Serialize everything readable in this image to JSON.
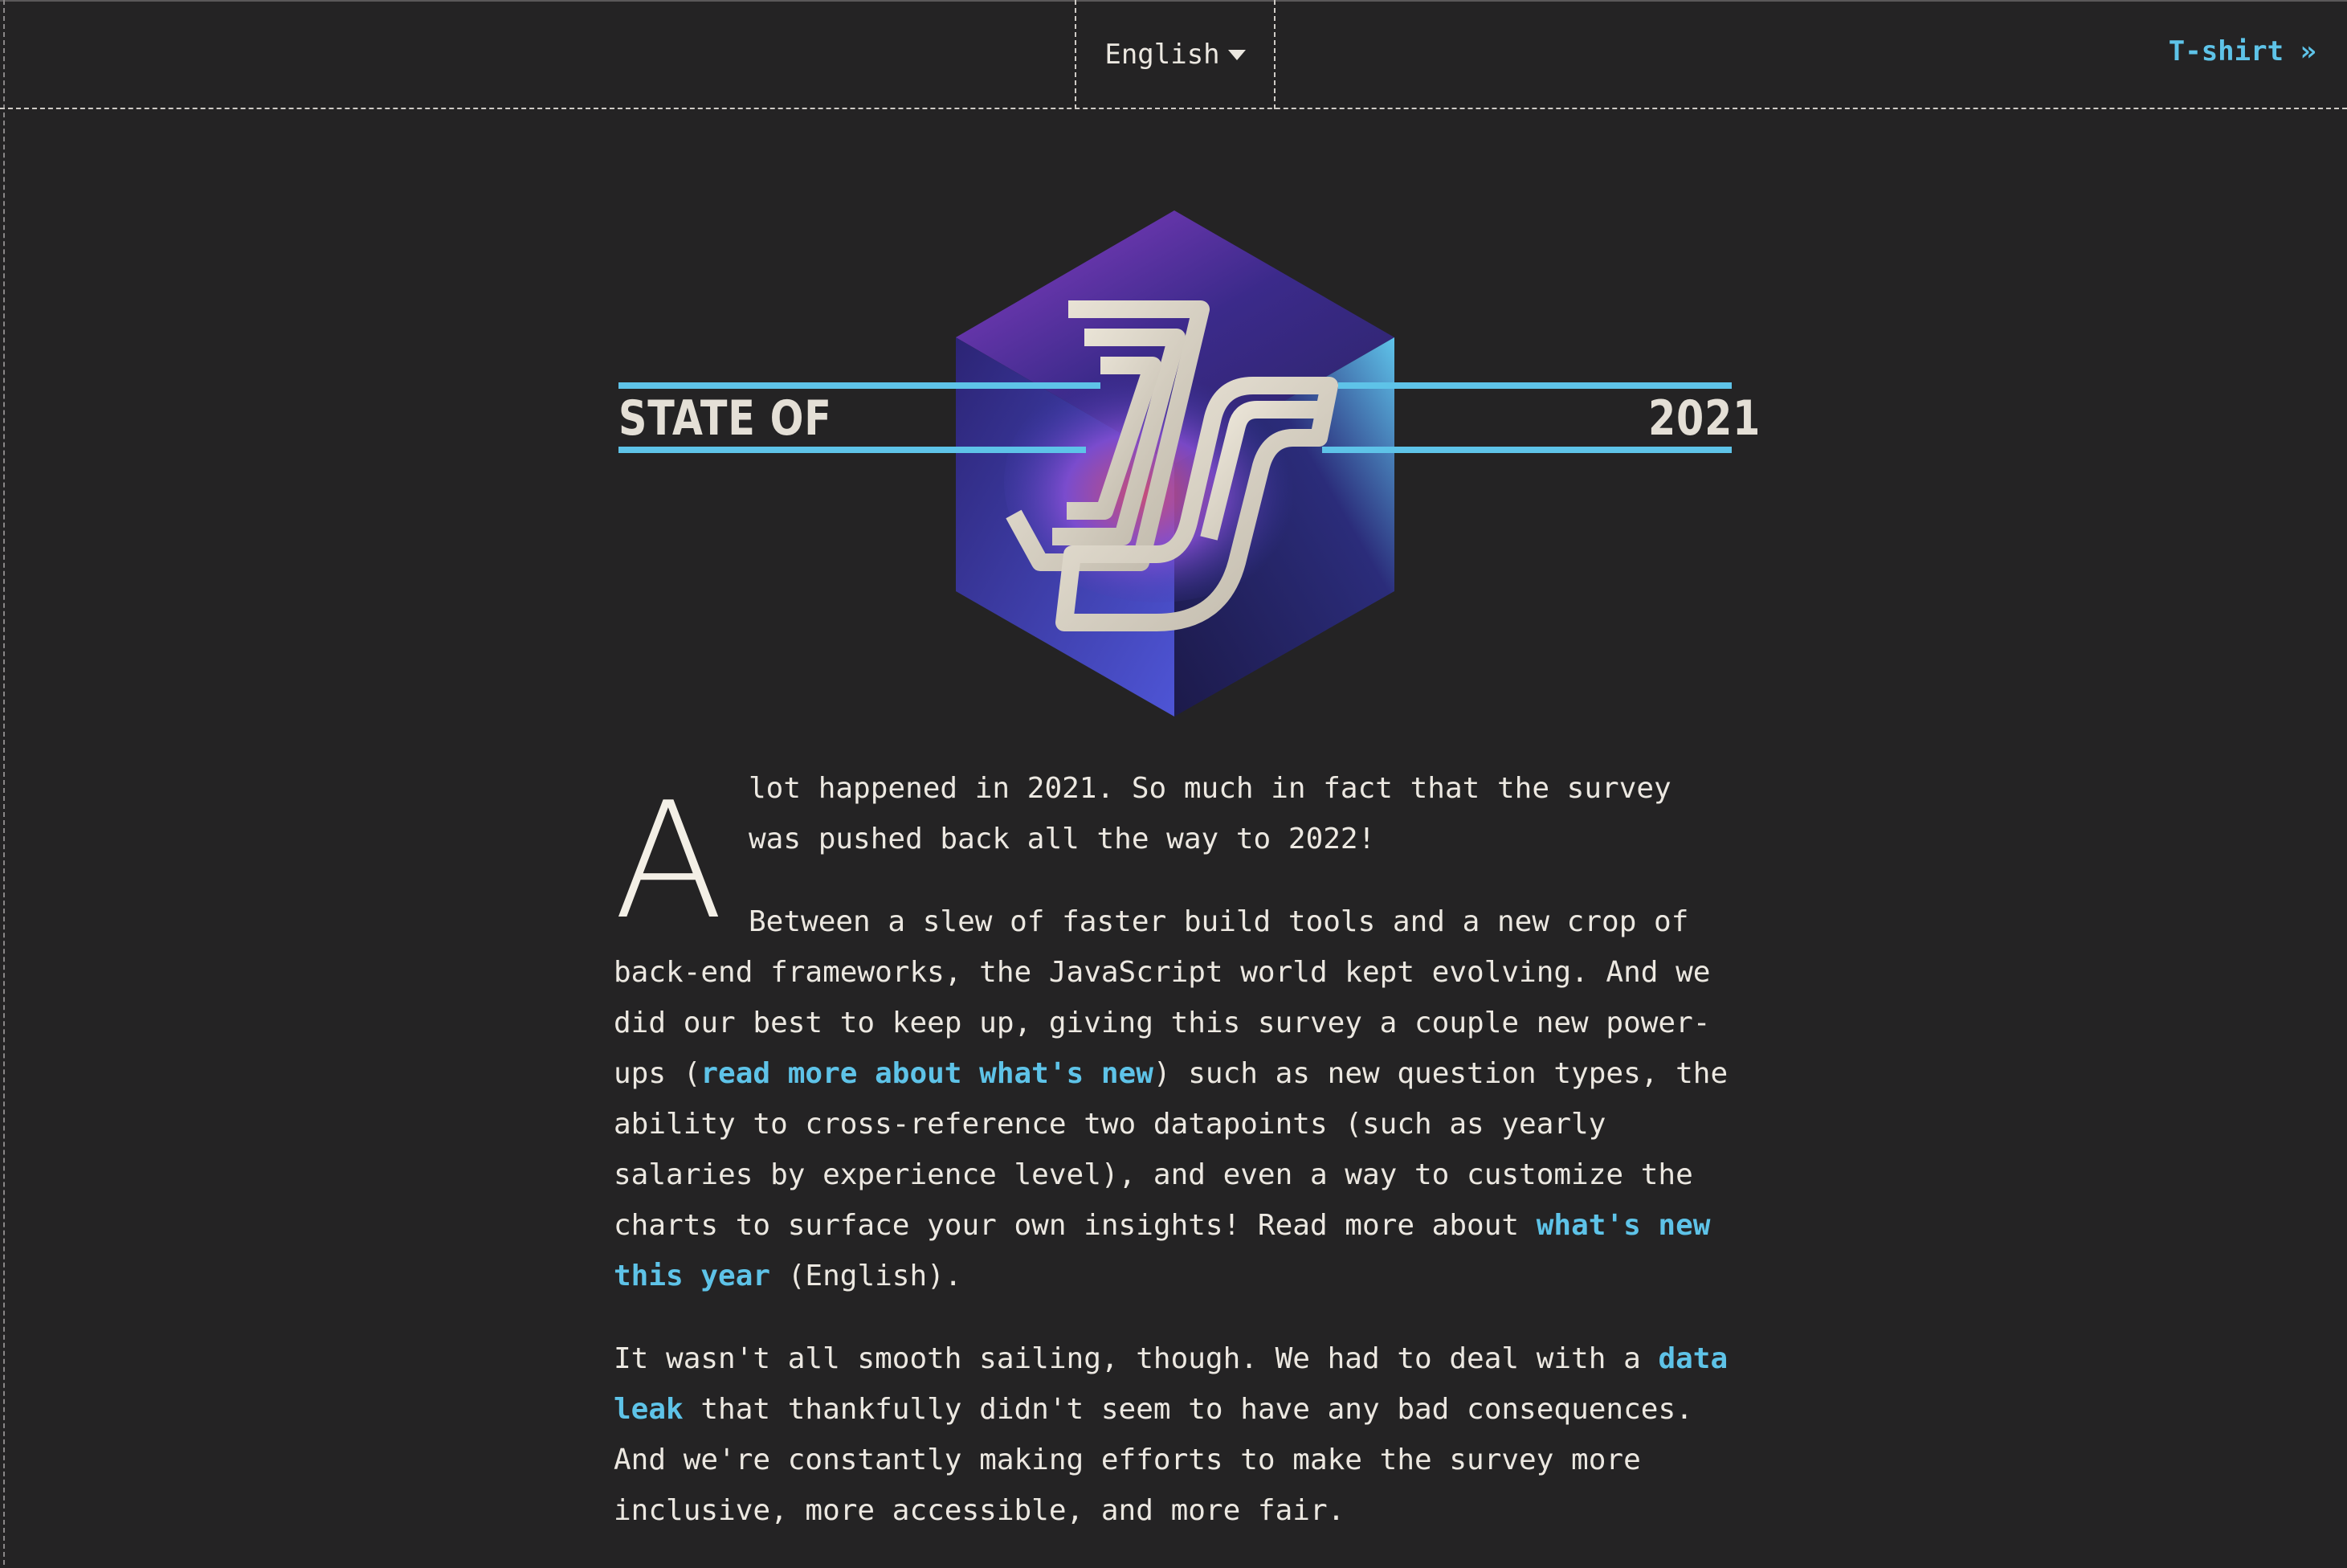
{
  "header": {
    "language": "English",
    "tshirt_link": "T-shirt »"
  },
  "logo": {
    "left_text": "STATE OF",
    "right_text": "2021"
  },
  "intro": {
    "dropcap": "A",
    "p1": "lot happened in 2021. So much in fact that the survey was pushed back all the way to 2022!",
    "p2_a": "Between a slew of faster build tools and a new crop of back-end frameworks, the JavaScript world kept evolving. And we did our best to keep up, giving this survey a couple new power-ups (",
    "p2_link1": "read more about what's new",
    "p2_b": ") such as new question types, the ability to cross-reference two datapoints (such as yearly salaries by experience level), and even a way to customize the charts to surface your own insights! Read more about ",
    "p2_link2": "what's new this year",
    "p2_c": " (English).",
    "p3_a": "It wasn't all smooth sailing, though. We had to deal with a ",
    "p3_link": "data leak",
    "p3_b": " that thankfully didn't seem to have any bad consequences. And we're constantly making efforts to make the survey more inclusive, more accessible, and more fair."
  },
  "colors": {
    "background": "#242324",
    "accent": "#5ec3e8",
    "text": "#ece8e1"
  }
}
